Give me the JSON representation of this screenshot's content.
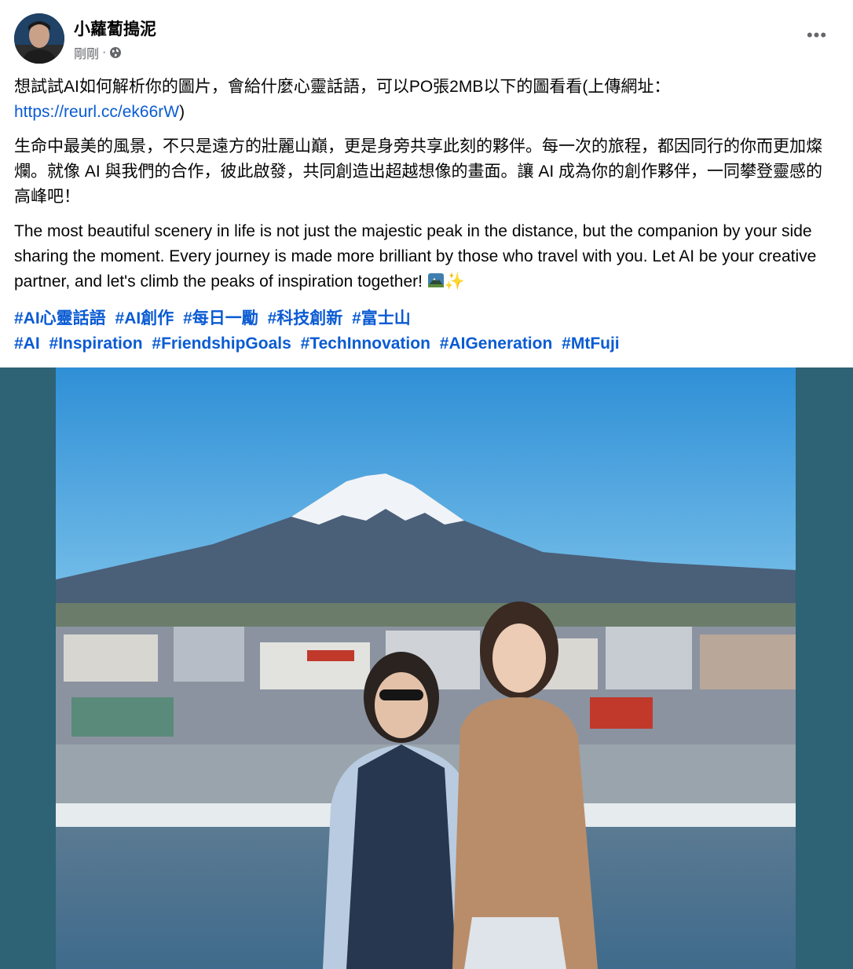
{
  "post": {
    "author": "小蘿蔔搗泥",
    "time": "剛剛",
    "time_separator": "·",
    "privacy_icon": "globe-icon",
    "more_icon": "more-icon",
    "more_label": "•••"
  },
  "text": {
    "line1_prefix": "想試試AI如何解析你的圖片，會給什麼心靈話語，可以PO張2MB以下的圖看看(上傳網址：",
    "link": "https://reurl.cc/ek66rW",
    "line1_suffix": ")",
    "paragraph_zh": "生命中最美的風景，不只是遠方的壯麗山巔，更是身旁共享此刻的夥伴。每一次的旅程，都因同行的你而更加燦爛。就像 AI 與我們的合作，彼此啟發，共同創造出超越想像的畫面。讓 AI 成為你的創作夥伴，一同攀登靈感的高峰吧！",
    "paragraph_en": "The most beautiful scenery in life is not just the majestic peak in the distance, but the companion by your side sharing the moment. Every journey is made more brilliant by those who travel with you. Let AI be your creative partner, and let's climb the peaks of inspiration together!",
    "sparkle": "✨",
    "mountain_emoji_icon": "mountain-emoji-icon"
  },
  "hashtags_zh": [
    "#AI心靈話語",
    "#AI創作",
    "#每日一勵",
    "#科技創新",
    "#富士山"
  ],
  "hashtags_en": [
    "#AI",
    "#Inspiration",
    "#FriendshipGoals",
    "#TechInnovation",
    "#AIGeneration",
    "#MtFuji"
  ],
  "colors": {
    "link": "#0a5bd3",
    "meta": "#65676b",
    "photo_background": "#2e6275",
    "sky": "#3e9bd8"
  }
}
